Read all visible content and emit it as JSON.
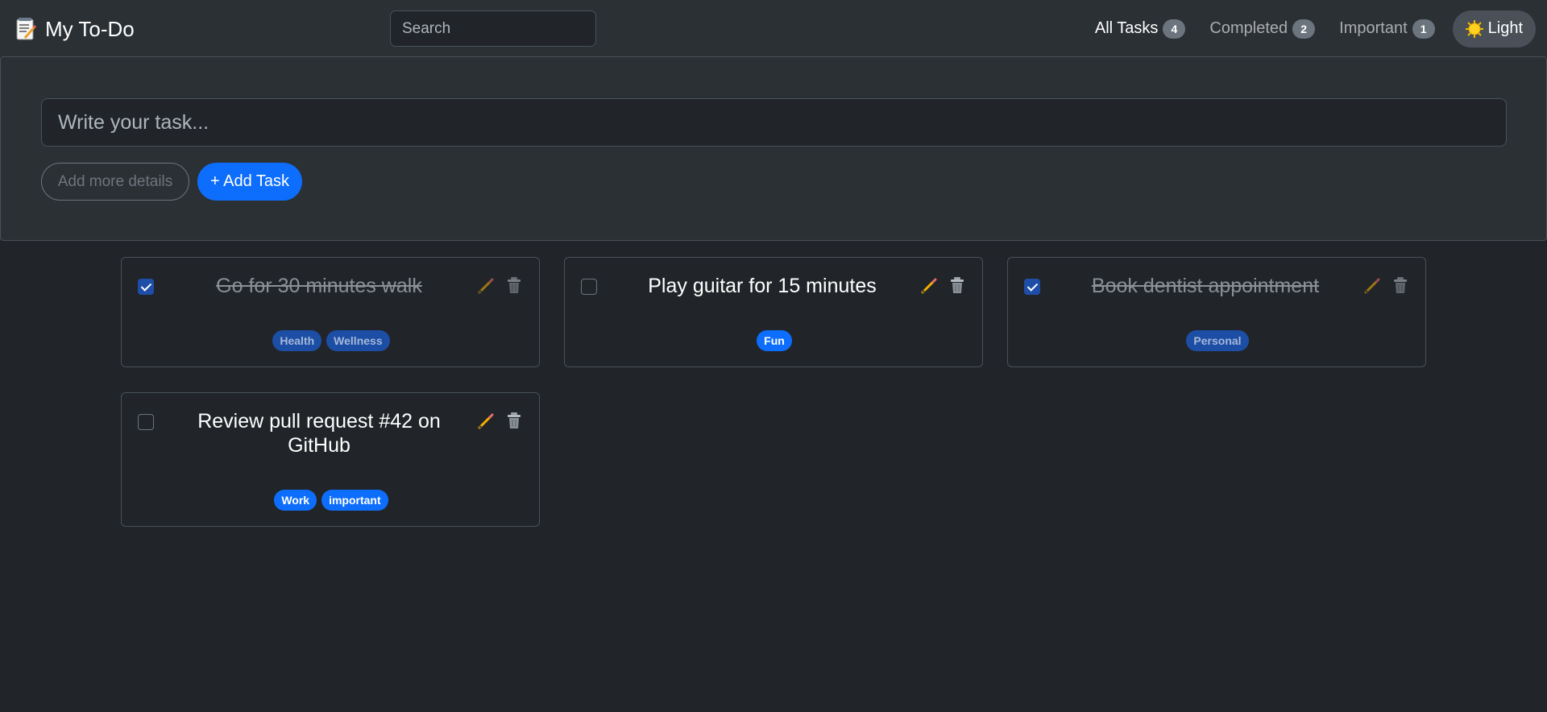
{
  "app": {
    "title": "My To-Do"
  },
  "search": {
    "placeholder": "Search"
  },
  "nav": {
    "all": {
      "label": "All Tasks",
      "count": "4"
    },
    "completed": {
      "label": "Completed",
      "count": "2"
    },
    "important": {
      "label": "Important",
      "count": "1"
    },
    "theme": {
      "label": "Light",
      "icon": "sun-icon"
    }
  },
  "composer": {
    "placeholder": "Write your task...",
    "details_label": "Add more details",
    "add_label": "+ Add Task"
  },
  "colors": {
    "accent": "#0d6efd",
    "background": "#212529",
    "panel": "#2b3035"
  },
  "tasks": [
    {
      "title": "Go for 30 minutes walk",
      "completed": true,
      "tags": [
        "Health",
        "Wellness"
      ]
    },
    {
      "title": "Play guitar for 15 minutes",
      "completed": false,
      "tags": [
        "Fun"
      ]
    },
    {
      "title": "Book dentist appointment",
      "completed": true,
      "tags": [
        "Personal"
      ]
    },
    {
      "title": "Review pull request #42 on GitHub",
      "completed": false,
      "tags": [
        "Work",
        "important"
      ]
    }
  ]
}
